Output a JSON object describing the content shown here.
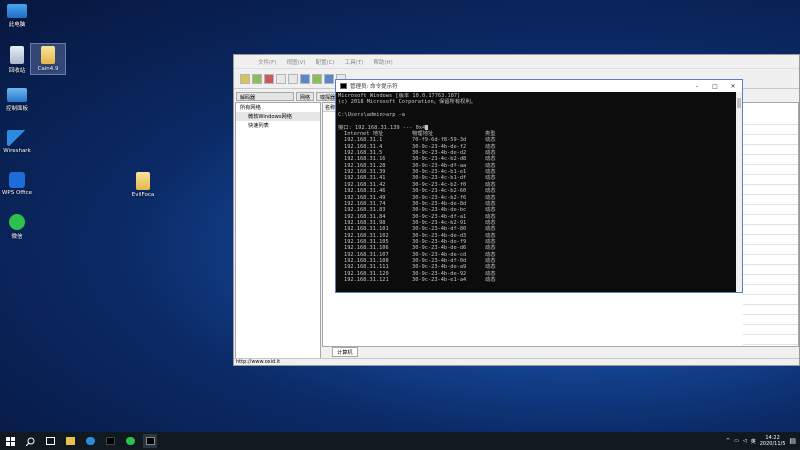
{
  "desktop_icons": [
    {
      "label": "此电脑"
    },
    {
      "label": "回收站"
    },
    {
      "label": "Cain4.9"
    },
    {
      "label": "控制面板"
    },
    {
      "label": "Wireshark"
    },
    {
      "label": "WPS Office"
    },
    {
      "label": "EvilFoca"
    },
    {
      "label": "微信"
    }
  ],
  "cain": {
    "menu": [
      "文件(F)",
      "视图(V)",
      "配置(C)",
      "工具(T)",
      "帮助(H)"
    ],
    "tabs": [
      "解码器",
      "网络",
      "嗅探器"
    ],
    "tree": [
      "所有网络",
      "微软Windows网络",
      "快速列表"
    ],
    "col_header": "名称",
    "sheet_tab": "计算机",
    "status": "http://www.oxid.it"
  },
  "cmd": {
    "title": "管理员: 命令提示符",
    "lines": [
      "Microsoft Windows [版本 10.0.17763.107]",
      "(c) 2018 Microsoft Corporation。保留所有权利。",
      "",
      "C:\\Users\\admin>arp -a",
      "",
      "接口: 192.168.31.139 --- 0x4"
    ],
    "table_header": {
      "ip": "Internet 地址",
      "mac": "物理地址",
      "type": "类型"
    },
    "rows": [
      {
        "ip": "192.168.31.1",
        "mac": "70-f9-6d-f8-59-3d",
        "type": "动态"
      },
      {
        "ip": "192.168.31.4",
        "mac": "30-9c-23-4b-de-f2",
        "type": "动态"
      },
      {
        "ip": "192.168.31.5",
        "mac": "30-9c-23-4b-de-d2",
        "type": "动态"
      },
      {
        "ip": "192.168.31.16",
        "mac": "30-9c-23-4c-b2-d8",
        "type": "动态"
      },
      {
        "ip": "192.168.31.28",
        "mac": "30-9c-23-4b-df-aa",
        "type": "动态"
      },
      {
        "ip": "192.168.31.39",
        "mac": "30-9c-23-4c-b1-e1",
        "type": "动态"
      },
      {
        "ip": "192.168.31.41",
        "mac": "30-9c-23-4c-b1-df",
        "type": "动态"
      },
      {
        "ip": "192.168.31.42",
        "mac": "30-9c-23-4c-b2-f0",
        "type": "动态"
      },
      {
        "ip": "192.168.31.46",
        "mac": "30-9c-23-4c-b2-60",
        "type": "动态"
      },
      {
        "ip": "192.168.31.49",
        "mac": "30-9c-23-4c-b2-f6",
        "type": "动态"
      },
      {
        "ip": "192.168.31.74",
        "mac": "30-9c-23-4b-de-8d",
        "type": "动态"
      },
      {
        "ip": "192.168.31.83",
        "mac": "30-9c-23-4b-de-bc",
        "type": "动态"
      },
      {
        "ip": "192.168.31.84",
        "mac": "30-9c-23-4b-df-a1",
        "type": "动态"
      },
      {
        "ip": "192.168.31.98",
        "mac": "30-9c-23-4c-b2-91",
        "type": "动态"
      },
      {
        "ip": "192.168.31.101",
        "mac": "30-9c-23-4b-df-80",
        "type": "动态"
      },
      {
        "ip": "192.168.31.102",
        "mac": "30-9c-23-4b-de-d3",
        "type": "动态"
      },
      {
        "ip": "192.168.31.105",
        "mac": "30-9c-23-4b-de-f9",
        "type": "动态"
      },
      {
        "ip": "192.168.31.106",
        "mac": "30-9c-23-4b-de-d6",
        "type": "动态"
      },
      {
        "ip": "192.168.31.107",
        "mac": "30-9c-23-4b-de-cd",
        "type": "动态"
      },
      {
        "ip": "192.168.31.108",
        "mac": "30-9c-23-4b-df-0d",
        "type": "动态"
      },
      {
        "ip": "192.168.31.111",
        "mac": "30-9c-23-4b-de-a9",
        "type": "动态"
      },
      {
        "ip": "192.168.31.120",
        "mac": "30-9c-23-4b-de-92",
        "type": "动态"
      },
      {
        "ip": "192.168.31.121",
        "mac": "30-9c-23-4b-e1-a4",
        "type": "动态"
      }
    ]
  },
  "taskbar": {
    "time": "14:22",
    "date": "2020/11/5",
    "lang": "英"
  }
}
